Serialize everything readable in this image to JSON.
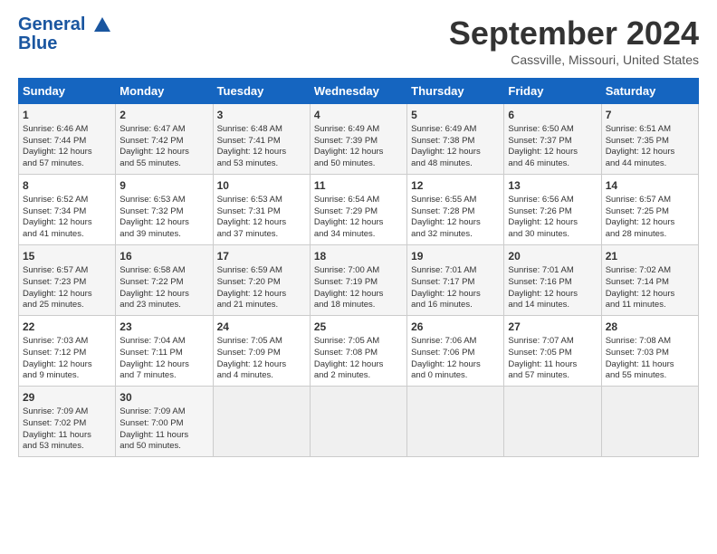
{
  "header": {
    "logo_line1": "General",
    "logo_line2": "Blue",
    "month": "September 2024",
    "location": "Cassville, Missouri, United States"
  },
  "days_of_week": [
    "Sunday",
    "Monday",
    "Tuesday",
    "Wednesday",
    "Thursday",
    "Friday",
    "Saturday"
  ],
  "weeks": [
    [
      {
        "day": "1",
        "text": "Sunrise: 6:46 AM\nSunset: 7:44 PM\nDaylight: 12 hours\nand 57 minutes."
      },
      {
        "day": "2",
        "text": "Sunrise: 6:47 AM\nSunset: 7:42 PM\nDaylight: 12 hours\nand 55 minutes."
      },
      {
        "day": "3",
        "text": "Sunrise: 6:48 AM\nSunset: 7:41 PM\nDaylight: 12 hours\nand 53 minutes."
      },
      {
        "day": "4",
        "text": "Sunrise: 6:49 AM\nSunset: 7:39 PM\nDaylight: 12 hours\nand 50 minutes."
      },
      {
        "day": "5",
        "text": "Sunrise: 6:49 AM\nSunset: 7:38 PM\nDaylight: 12 hours\nand 48 minutes."
      },
      {
        "day": "6",
        "text": "Sunrise: 6:50 AM\nSunset: 7:37 PM\nDaylight: 12 hours\nand 46 minutes."
      },
      {
        "day": "7",
        "text": "Sunrise: 6:51 AM\nSunset: 7:35 PM\nDaylight: 12 hours\nand 44 minutes."
      }
    ],
    [
      {
        "day": "8",
        "text": "Sunrise: 6:52 AM\nSunset: 7:34 PM\nDaylight: 12 hours\nand 41 minutes."
      },
      {
        "day": "9",
        "text": "Sunrise: 6:53 AM\nSunset: 7:32 PM\nDaylight: 12 hours\nand 39 minutes."
      },
      {
        "day": "10",
        "text": "Sunrise: 6:53 AM\nSunset: 7:31 PM\nDaylight: 12 hours\nand 37 minutes."
      },
      {
        "day": "11",
        "text": "Sunrise: 6:54 AM\nSunset: 7:29 PM\nDaylight: 12 hours\nand 34 minutes."
      },
      {
        "day": "12",
        "text": "Sunrise: 6:55 AM\nSunset: 7:28 PM\nDaylight: 12 hours\nand 32 minutes."
      },
      {
        "day": "13",
        "text": "Sunrise: 6:56 AM\nSunset: 7:26 PM\nDaylight: 12 hours\nand 30 minutes."
      },
      {
        "day": "14",
        "text": "Sunrise: 6:57 AM\nSunset: 7:25 PM\nDaylight: 12 hours\nand 28 minutes."
      }
    ],
    [
      {
        "day": "15",
        "text": "Sunrise: 6:57 AM\nSunset: 7:23 PM\nDaylight: 12 hours\nand 25 minutes."
      },
      {
        "day": "16",
        "text": "Sunrise: 6:58 AM\nSunset: 7:22 PM\nDaylight: 12 hours\nand 23 minutes."
      },
      {
        "day": "17",
        "text": "Sunrise: 6:59 AM\nSunset: 7:20 PM\nDaylight: 12 hours\nand 21 minutes."
      },
      {
        "day": "18",
        "text": "Sunrise: 7:00 AM\nSunset: 7:19 PM\nDaylight: 12 hours\nand 18 minutes."
      },
      {
        "day": "19",
        "text": "Sunrise: 7:01 AM\nSunset: 7:17 PM\nDaylight: 12 hours\nand 16 minutes."
      },
      {
        "day": "20",
        "text": "Sunrise: 7:01 AM\nSunset: 7:16 PM\nDaylight: 12 hours\nand 14 minutes."
      },
      {
        "day": "21",
        "text": "Sunrise: 7:02 AM\nSunset: 7:14 PM\nDaylight: 12 hours\nand 11 minutes."
      }
    ],
    [
      {
        "day": "22",
        "text": "Sunrise: 7:03 AM\nSunset: 7:12 PM\nDaylight: 12 hours\nand 9 minutes."
      },
      {
        "day": "23",
        "text": "Sunrise: 7:04 AM\nSunset: 7:11 PM\nDaylight: 12 hours\nand 7 minutes."
      },
      {
        "day": "24",
        "text": "Sunrise: 7:05 AM\nSunset: 7:09 PM\nDaylight: 12 hours\nand 4 minutes."
      },
      {
        "day": "25",
        "text": "Sunrise: 7:05 AM\nSunset: 7:08 PM\nDaylight: 12 hours\nand 2 minutes."
      },
      {
        "day": "26",
        "text": "Sunrise: 7:06 AM\nSunset: 7:06 PM\nDaylight: 12 hours\nand 0 minutes."
      },
      {
        "day": "27",
        "text": "Sunrise: 7:07 AM\nSunset: 7:05 PM\nDaylight: 11 hours\nand 57 minutes."
      },
      {
        "day": "28",
        "text": "Sunrise: 7:08 AM\nSunset: 7:03 PM\nDaylight: 11 hours\nand 55 minutes."
      }
    ],
    [
      {
        "day": "29",
        "text": "Sunrise: 7:09 AM\nSunset: 7:02 PM\nDaylight: 11 hours\nand 53 minutes."
      },
      {
        "day": "30",
        "text": "Sunrise: 7:09 AM\nSunset: 7:00 PM\nDaylight: 11 hours\nand 50 minutes."
      },
      {
        "day": "",
        "text": ""
      },
      {
        "day": "",
        "text": ""
      },
      {
        "day": "",
        "text": ""
      },
      {
        "day": "",
        "text": ""
      },
      {
        "day": "",
        "text": ""
      }
    ]
  ]
}
